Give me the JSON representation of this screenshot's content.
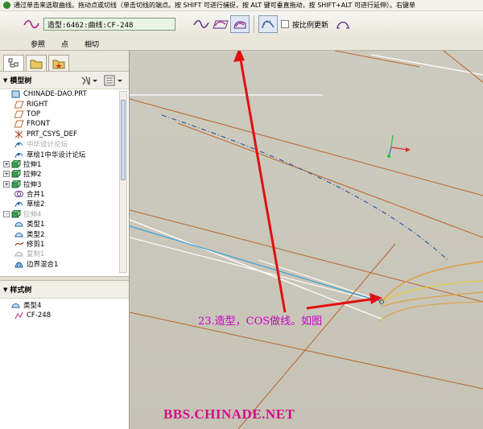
{
  "message_bar": {
    "text": "通过单击来选取曲线。拖动点或切线（单击切线的端点。按 SHIFT 可进行捕捉，按 ALT 键可垂直拖动，按 SHIFT+ALT 可进行延伸）。右键单"
  },
  "toolbar": {
    "curve_field_value": "造型:6462:曲线:CF-248",
    "scale_update_label": "按比例更新"
  },
  "tabs": [
    {
      "label": "参照"
    },
    {
      "label": "点"
    },
    {
      "label": "相切"
    }
  ],
  "model_tree": {
    "title": "模型树",
    "items": [
      {
        "label": "CHINADE-DAO.PRT",
        "icon": "part-icon",
        "expand": false,
        "gray": false,
        "indent": 0
      },
      {
        "label": "RIGHT",
        "icon": "datum-plane-icon",
        "expand": false,
        "gray": false,
        "indent": 1
      },
      {
        "label": "TOP",
        "icon": "datum-plane-icon",
        "expand": false,
        "gray": false,
        "indent": 1
      },
      {
        "label": "FRONT",
        "icon": "datum-plane-icon",
        "expand": false,
        "gray": false,
        "indent": 1
      },
      {
        "label": "PRT_CSYS_DEF",
        "icon": "csys-icon",
        "expand": false,
        "gray": false,
        "indent": 1
      },
      {
        "label": "中华设计论坛",
        "icon": "sketch-icon",
        "expand": false,
        "gray": true,
        "indent": 1
      },
      {
        "label": "草绘1中华设计论坛",
        "icon": "sketch-icon",
        "expand": false,
        "gray": false,
        "indent": 1
      },
      {
        "label": "拉伸1",
        "icon": "extrude-icon",
        "expand": true,
        "gray": false,
        "indent": 0
      },
      {
        "label": "拉伸2",
        "icon": "extrude-icon",
        "expand": true,
        "gray": false,
        "indent": 0
      },
      {
        "label": "拉伸3",
        "icon": "extrude-icon",
        "expand": true,
        "gray": false,
        "indent": 0
      },
      {
        "label": "合并1",
        "icon": "merge-icon",
        "expand": false,
        "gray": false,
        "indent": 1
      },
      {
        "label": "草绘2",
        "icon": "sketch-icon",
        "expand": false,
        "gray": false,
        "indent": 1
      },
      {
        "label": "拉伸4",
        "icon": "extrude-icon",
        "expand": true,
        "gray": true,
        "indent": 0
      },
      {
        "label": "类型1",
        "icon": "style-icon",
        "expand": false,
        "gray": false,
        "indent": 1
      },
      {
        "label": "类型2",
        "icon": "style-icon",
        "expand": false,
        "gray": false,
        "indent": 1
      },
      {
        "label": "修剪1",
        "icon": "trim-icon",
        "expand": false,
        "gray": false,
        "indent": 1
      },
      {
        "label": "复制1",
        "icon": "copy-icon",
        "expand": false,
        "gray": true,
        "indent": 1
      },
      {
        "label": "边界混合1",
        "icon": "boundary-icon",
        "expand": false,
        "gray": false,
        "indent": 1
      }
    ]
  },
  "style_tree": {
    "title": "样式树",
    "items": [
      {
        "label": "类型4",
        "icon": "style-icon",
        "indent": 0
      },
      {
        "label": "CF-248",
        "icon": "curve-icon",
        "indent": 1
      }
    ]
  },
  "annotation": {
    "text": "23.造型，COS做线。如图"
  },
  "watermark": {
    "text": "BBS.CHINADE.NET"
  },
  "colors": {
    "annotation": "#c800c8",
    "watermark": "#d80a8a",
    "arrow": "#e01010",
    "datum_plane": "#b8652a",
    "curve_cyan": "#3aa0d8",
    "curve_orange": "#e0a040"
  }
}
